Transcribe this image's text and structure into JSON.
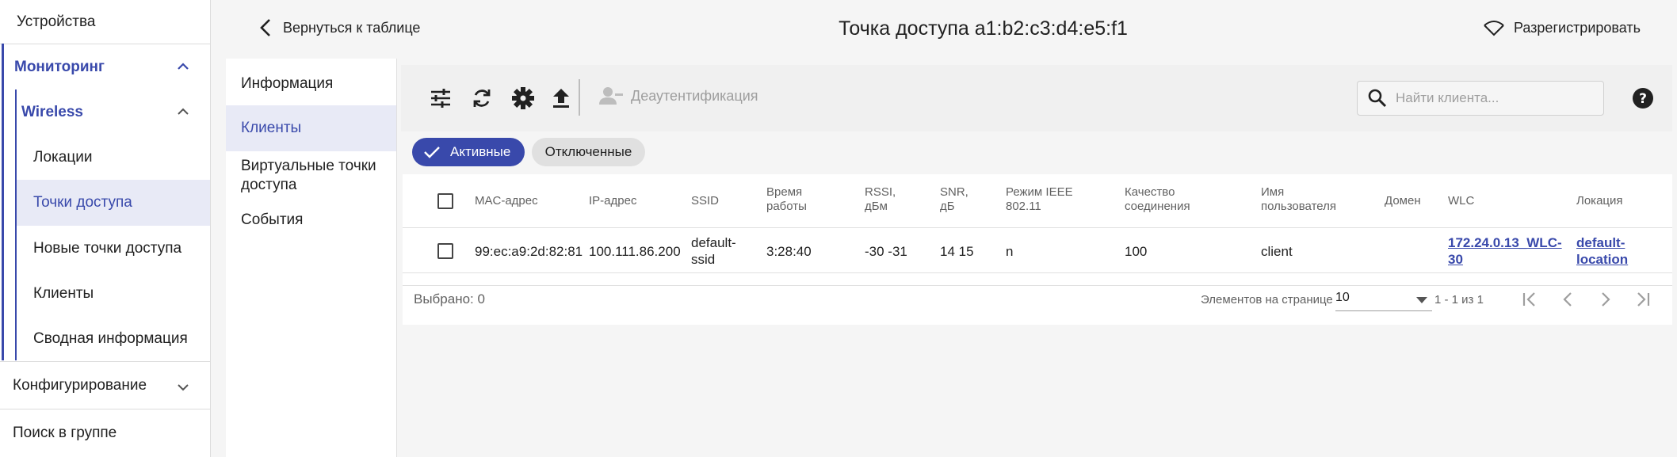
{
  "sidebar": {
    "devices": "Устройства",
    "monitoring": "Мониторинг",
    "wireless": "Wireless",
    "locations": "Локации",
    "access_points": "Точки доступа",
    "new_access_points": "Новые точки доступа",
    "clients": "Клиенты",
    "summary": "Сводная информация",
    "configuration": "Конфигурирование",
    "group_search": "Поиск в группе"
  },
  "header": {
    "back_label": "Вернуться к таблице",
    "title": "Точка доступа a1:b2:c3:d4:e5:f1",
    "unregister_label": "Разрегистрировать"
  },
  "inner_nav": {
    "info": "Информация",
    "clients": "Клиенты",
    "virtual_aps": "Виртуальные точки доступа",
    "events": "События"
  },
  "toolbar": {
    "icons": [
      "tune-icon",
      "refresh-icon",
      "gear-icon",
      "upload-icon"
    ],
    "deauth_label": "Деаутентификация",
    "search_placeholder": "Найти клиента..."
  },
  "filters": {
    "active": "Активные",
    "disconnected": "Отключенные"
  },
  "table": {
    "headers": {
      "mac": "MAC-адрес",
      "ip": "IP-адрес",
      "ssid": "SSID",
      "uptime_1": "Время",
      "uptime_2": "работы",
      "rssi_1": "RSSI,",
      "rssi_2": "дБм",
      "snr_1": "SNR,",
      "snr_2": "дБ",
      "ieee_1": "Режим IEEE",
      "ieee_2": "802.11",
      "quality_1": "Качество",
      "quality_2": "соединения",
      "user_1": "Имя",
      "user_2": "пользователя",
      "domain": "Домен",
      "wlc": "WLC",
      "location": "Локация"
    },
    "rows": [
      {
        "mac": "99:ec:a9:2d:82:81",
        "ip": "100.111.86.200",
        "ssid_1": "default-",
        "ssid_2": "ssid",
        "uptime": "3:28:40",
        "rssi": "-30 -31",
        "snr": "14 15",
        "ieee": "n",
        "quality": "100",
        "user": "client",
        "domain": "",
        "wlc_1": "172.24.0.13_WLC-",
        "wlc_2": "30",
        "location_1": "default-",
        "location_2": "location"
      }
    ]
  },
  "footer": {
    "selected": "Выбрано: 0",
    "per_page_label": "Элементов на странице",
    "per_page_value": "10",
    "range": "1 - 1 из 1"
  },
  "colors": {
    "accent": "#3949ab",
    "active_bg": "#e8eaf6"
  }
}
